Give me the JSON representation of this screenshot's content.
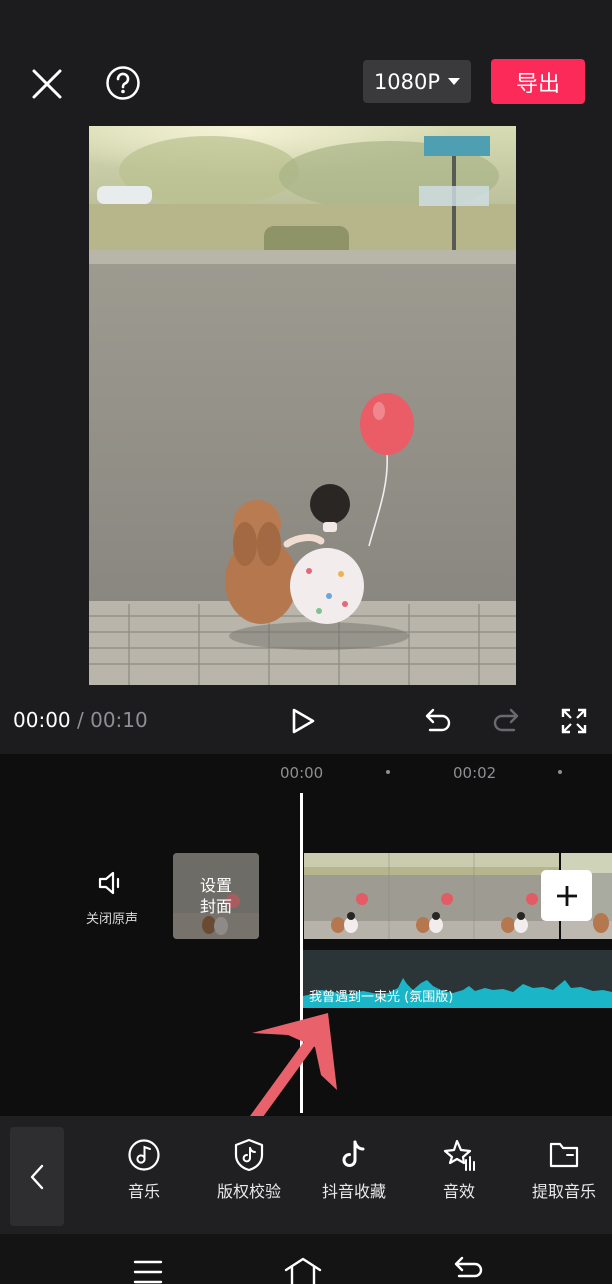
{
  "header": {
    "resolution_label": "1080P",
    "export_label": "导出"
  },
  "playback": {
    "current_time": "00:00",
    "separator": " / ",
    "total_time": "00:10"
  },
  "timeline": {
    "ticks": [
      "00:00",
      "00:02"
    ],
    "mute_label": "关闭原声",
    "cover_label": "设置\n封面",
    "audio_track_name": "我曾遇到一束光 (氛围版)"
  },
  "toolbar": {
    "items": [
      {
        "label": "音乐",
        "icon": "music-note-icon"
      },
      {
        "label": "版权校验",
        "icon": "shield-tiktok-icon"
      },
      {
        "label": "抖音收藏",
        "icon": "tiktok-icon"
      },
      {
        "label": "音效",
        "icon": "star-sound-icon"
      },
      {
        "label": "提取音乐",
        "icon": "folder-icon"
      }
    ]
  },
  "colors": {
    "accent": "#fb2a59",
    "audio_wave": "#1ab6c8",
    "annotation_arrow": "#e8616b"
  }
}
